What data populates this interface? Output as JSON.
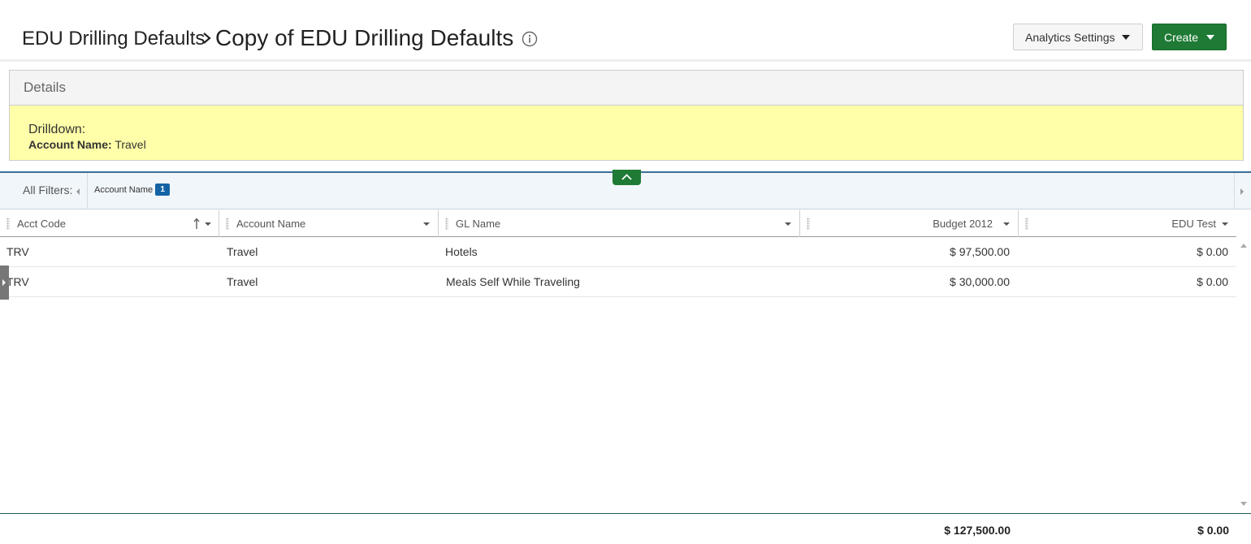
{
  "header": {
    "breadcrumb_parent": "EDU Drilling Defaults",
    "title": "Copy of EDU Drilling Defaults",
    "analytics_settings_label": "Analytics Settings",
    "create_label": "Create"
  },
  "details": {
    "heading": "Details",
    "drilldown_label": "Drilldown:",
    "filter_field": "Account Name:",
    "filter_value": "Travel"
  },
  "filters": {
    "label": "All Filters:",
    "chip_label": "Account Name",
    "chip_count": "1"
  },
  "grid": {
    "columns": [
      "Acct Code",
      "Account Name",
      "GL Name",
      "Budget 2012",
      "EDU Test"
    ],
    "rows": [
      {
        "acct_code": "TRV",
        "account_name": "Travel",
        "gl_name": "Hotels",
        "budget_2012": "$ 97,500.00",
        "edu_test": "$ 0.00"
      },
      {
        "acct_code": "TRV",
        "account_name": "Travel",
        "gl_name": "Meals Self While Traveling",
        "budget_2012": "$ 30,000.00",
        "edu_test": "$ 0.00"
      }
    ],
    "totals": {
      "budget_2012": "$ 127,500.00",
      "edu_test": "$ 0.00"
    }
  },
  "colors": {
    "accent_green": "#1e7a34",
    "filter_badge_blue": "#1464a5",
    "drilldown_yellow": "#ffffa9"
  }
}
